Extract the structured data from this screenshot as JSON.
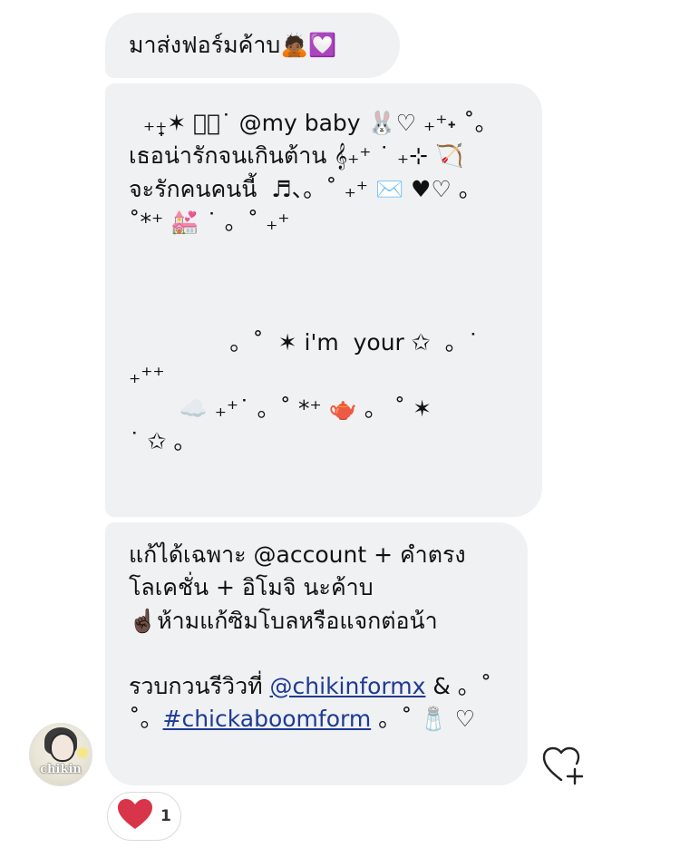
{
  "messages": {
    "first": {
      "text": "มาส่งฟอร์มค้าบ🙇🏾💟"
    },
    "form": {
      "lines": [
        "  ₊₊̟̟✶ ﾟ。˙ @my baby 🐰♡ ₊⁺˖ ˚。",
        "เธอน่ารักจนเกินต้าน 𝄞₊⁺ ˙ ₊⊹ 🏹",
        "จะรักคนคนนี้  ♬、。˚ ₊⁺ ✉️ ♥︎♡ 。",
        "˚*⁺ 💒 ˙ 。˚ ₊⁺",
        "",
        "              。˚  ✶ i'm  your ✩  。˙",
        "₊⁺⁺",
        "       ☁️ ₊⁺˙ 。˚ *⁺ 🫖 。 ˚ ✶",
        "˙ ✩ 。"
      ]
    },
    "note": {
      "line1": "แก้ได้เฉพาะ @account + คำตรง",
      "line2": "โลเคชั่น + อิโมจิ นะค้าบ",
      "line3": "☝🏿ห้ามแก้ซิมโบลหรือแจกต่อน้า",
      "line4_prefix": "รวบกวนรีวิวที่ ",
      "line4_link": "@chikinformx",
      "line4_suffix": " & 。˚",
      "line5_prefix": "˚。",
      "line5_link": "#chickaboomform",
      "line5_suffix": " 。˚ 🧂 ♡"
    }
  },
  "avatar": {
    "label": "chikin"
  },
  "reaction": {
    "emoji": "heart-icon",
    "count": "1"
  },
  "actions": {
    "add_reaction_icon": "heart-plus-icon"
  },
  "colors": {
    "bubble": "#eff1f3",
    "link": "#1f3a93",
    "heart": "#d8344a"
  }
}
